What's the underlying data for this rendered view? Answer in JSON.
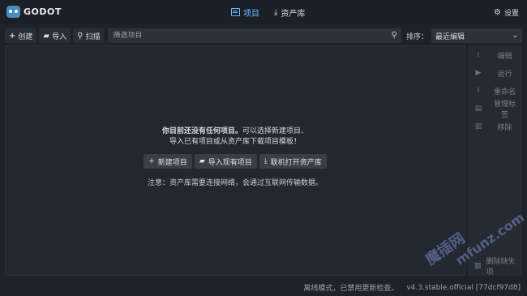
{
  "app": {
    "name": "GODOT"
  },
  "tabs": [
    {
      "label": "项目",
      "active": true
    },
    {
      "label": "资产库",
      "active": false
    }
  ],
  "settings_label": "设置",
  "toolbar": {
    "create_label": "创建",
    "import_label": "导入",
    "scan_label": "扫描",
    "filter_placeholder": "筛选项目",
    "sort_label": "排序：",
    "sort_value": "最近编辑"
  },
  "side_actions": [
    {
      "label": "编辑",
      "icon": "pencil-icon"
    },
    {
      "label": "运行",
      "icon": "play-icon"
    },
    {
      "label": "重命名",
      "icon": "text-cursor-icon"
    },
    {
      "label": "管理标签",
      "icon": "tag-icon"
    },
    {
      "label": "移除",
      "icon": "trash-icon"
    }
  ],
  "remove_missing_label": "删除缺失项",
  "empty_state": {
    "line1_bold": "你目前还没有任何项目。",
    "line1_rest": "可以选择新建项目、",
    "line2": "导入已有项目或从资产库下载项目模板！",
    "buttons": {
      "new_project": "新建项目",
      "import_existing": "导入现有项目",
      "open_asset_lib": "联机打开资产库"
    },
    "note": "注意：资产库需要连接网络，会通过互联网传输数据。"
  },
  "status": {
    "mode": "离线模式，已禁用更新检查。",
    "version": "v4.3.stable.official [77dcf97d8]"
  },
  "watermark": {
    "line1": "魔插网",
    "line2": "mfunz.com"
  },
  "colors": {
    "accent": "#70b8ff",
    "background": "#1e222a",
    "panel": "#262b33"
  }
}
